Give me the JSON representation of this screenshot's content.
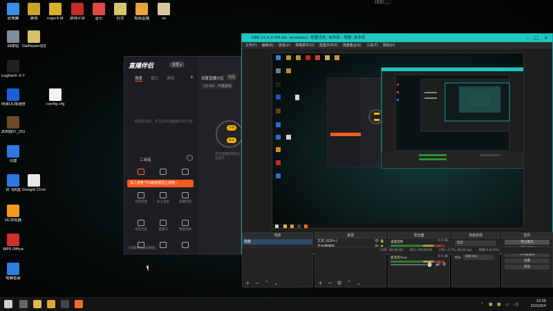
{
  "desktop": {
    "icons": [
      {
        "label": "此电脑",
        "color": "#3a8ee6"
      },
      {
        "label": "游戏",
        "color": "#c9a227"
      },
      {
        "label": "csgo平台",
        "color": "#d7b02a"
      },
      {
        "label": "游戏平台",
        "color": "#c42b2b"
      },
      {
        "label": "音乐",
        "color": "#e04848"
      },
      {
        "label": "社交",
        "color": "#d8c56c"
      },
      {
        "label": "视频直播",
        "color": "#e5a53a"
      },
      {
        "label": "ss",
        "color": "#d7c6a0"
      },
      {
        "label": "回收站",
        "color": "#7f8c99"
      },
      {
        "label": "Galilayen设置视频",
        "color": "#d8c06a"
      },
      {
        "label": "Logitech G HUB",
        "color": "#222222"
      },
      {
        "label": "网易UU加速器",
        "color": "#1a5fd6"
      },
      {
        "label": "config.cfg",
        "color": "#f2f2f2"
      },
      {
        "label": "其他图片_20211122...",
        "color": "#6b4a2a"
      },
      {
        "label": "迅雷",
        "color": "#3176e6"
      },
      {
        "label": "讯飞网盘",
        "color": "#2d77e0"
      },
      {
        "label": "Google Chrome",
        "color": "#e8e8e8"
      },
      {
        "label": "UC浏览器",
        "color": "#f39a1e"
      },
      {
        "label": "WPS Office",
        "color": "#d32f2f"
      },
      {
        "label": "电脑管家",
        "color": "#2f7de1"
      }
    ]
  },
  "top_overlay_label": "[][][] ___",
  "livestream_app": {
    "title": "直播伴侣",
    "badge": "未登 ▸",
    "tabs": [
      "场景",
      "窗口",
      "游戏"
    ],
    "empty_hint": "添加素材后，可在此管理画面中的内容",
    "tools_title": "工具箱",
    "tools": [
      "",
      "",
      "",
      "",
      "",
      "",
      "",
      ""
    ],
    "tool_labels": [
      "",
      "",
      "",
      "语音连麦",
      "多人连麦",
      "直播伴侣",
      "语音连麦",
      "直播间",
      "整理视频"
    ],
    "banner": "多人连麦下UI面板按钮上线啦~",
    "footer": "小直播伴侣多加数据",
    "right_title": "设置直播分区",
    "right_tag": "增值",
    "right_game": "CS:GO · 开播游戏",
    "live_pills": [
      "开播",
      "推流"
    ],
    "hint": "开启直播后将在这里显示"
  },
  "obs": {
    "title": "OBS 27.0.0 (64-bit, windows) - 配置文件: 未命名 - 场景: 未命名",
    "menu": [
      "文件(F)",
      "编辑(E)",
      "查看(V)",
      "停靠部件(D)",
      "配置文件(P)",
      "场景集合(S)",
      "工具(T)",
      "帮助(H)"
    ],
    "docks": {
      "scenes": {
        "title": "场景",
        "items": [
          "场景"
        ]
      },
      "sources": {
        "title": "来源",
        "items": [
          {
            "name": "文本 (GDI+)",
            "icons": "👁 🔒"
          },
          {
            "name": "显示器捕获",
            "icons": "👁 🔒"
          }
        ]
      },
      "mixer": {
        "title": "混音器",
        "channels": [
          {
            "name": "桌面音频",
            "db": "0.0 dB"
          },
          {
            "name": "麦克风/Aux",
            "db": "0.0 dB"
          }
        ]
      },
      "transitions": {
        "title": "场景转场",
        "mode": "淡出",
        "duration_label": "时长",
        "duration_value": "300 ms"
      },
      "controls": {
        "title": "控件",
        "buttons": [
          "停止推流",
          "开始录制",
          "工作室模式",
          "设置",
          "退出"
        ]
      }
    },
    "status": [
      "LIVE: 00:00:00",
      "REC: 00:00:00",
      "CPU: 2.7%, 60.00 fps",
      "帧数 0 (0.0%)"
    ]
  },
  "taskbar": {
    "clock_time": "10:06",
    "clock_date": "2022/6/4",
    "items": [
      {
        "name": "start-button",
        "color": "#d0d0d0"
      },
      {
        "name": "search-button",
        "color": "#666666"
      },
      {
        "name": "file-explorer",
        "color": "#e6b84a"
      },
      {
        "name": "browser",
        "color": "#e2a33a"
      },
      {
        "name": "obs-app",
        "color": "#444444"
      },
      {
        "name": "livestream-app",
        "color": "#ff6a2a"
      }
    ]
  }
}
